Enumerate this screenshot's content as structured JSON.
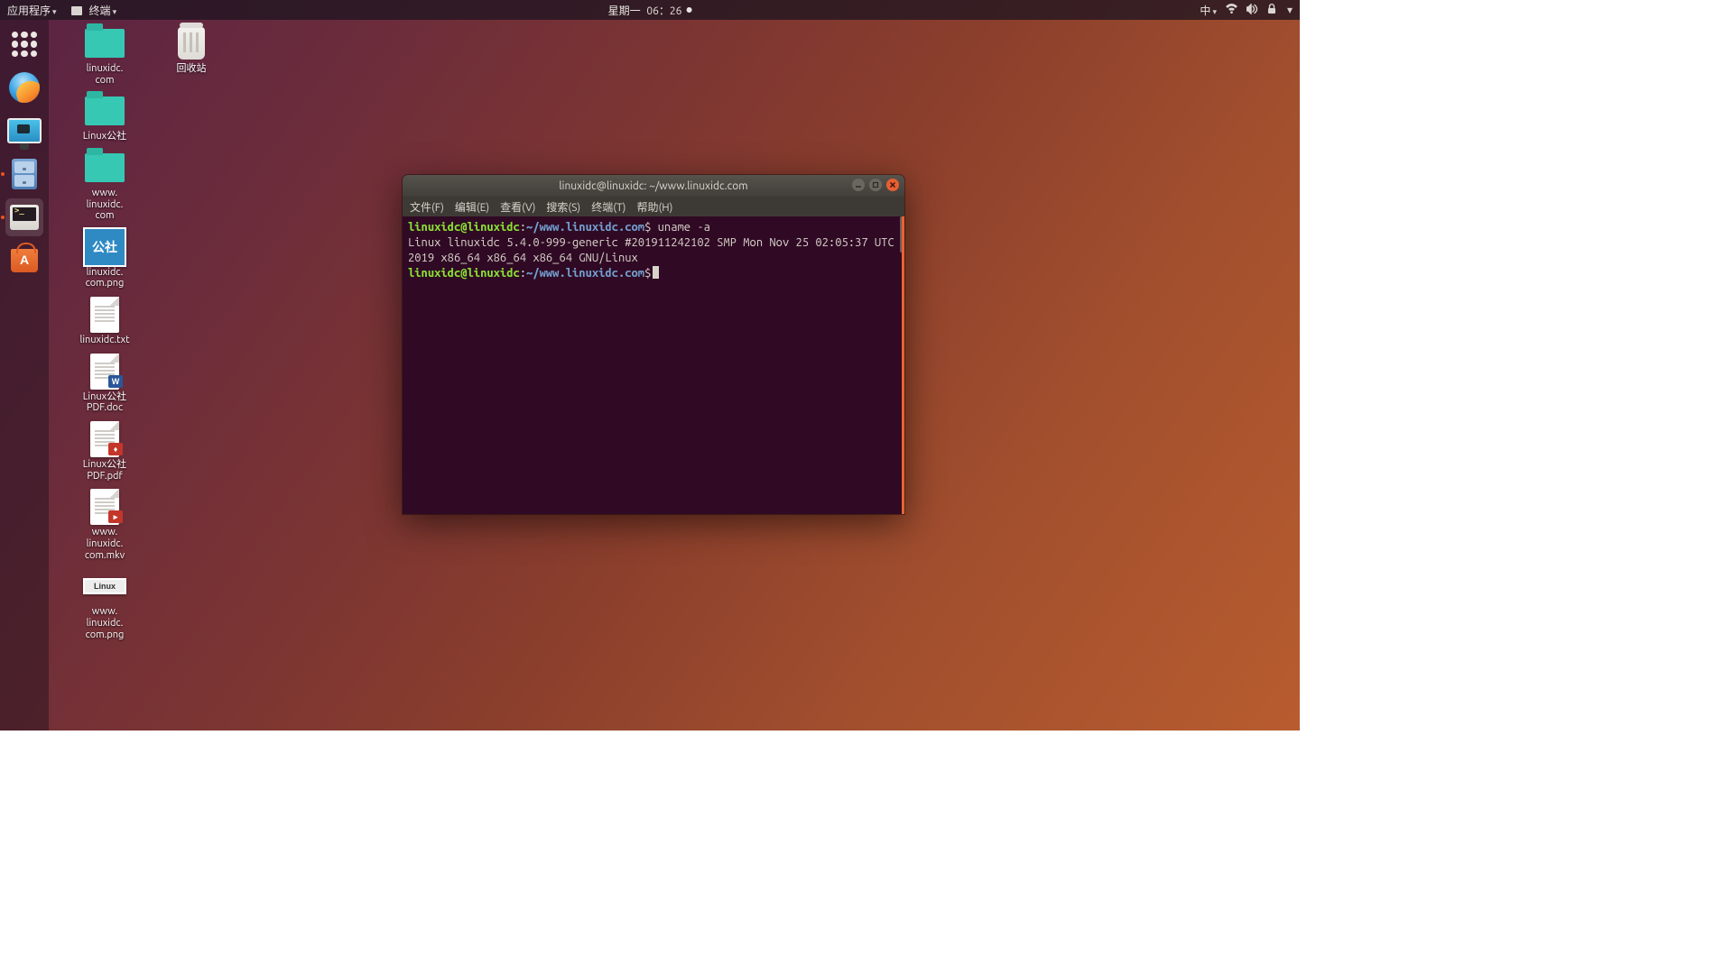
{
  "topbar": {
    "apps_label": "应用程序",
    "active_app": "终端",
    "date": "星期一",
    "time": "06：26",
    "ime": "中"
  },
  "desktop_icons": [
    {
      "type": "folder",
      "label": "linuxidc.\ncom"
    },
    {
      "type": "folder",
      "label": "Linux公社"
    },
    {
      "type": "folder",
      "label": "www.\nlinuxidc.\ncom"
    },
    {
      "type": "thumb",
      "thumb": "公社",
      "label": "linuxidc.\ncom.png"
    },
    {
      "type": "txt",
      "label": "linuxidc.txt"
    },
    {
      "type": "doc",
      "label": "Linux公社\nPDF.doc"
    },
    {
      "type": "pdf",
      "label": "Linux公社\nPDF.pdf"
    },
    {
      "type": "vid",
      "label": "www.\nlinuxidc.\ncom.mkv"
    },
    {
      "type": "smallthumb",
      "thumb": "Linux",
      "label": "www.\nlinuxidc.\ncom.png"
    }
  ],
  "trash_label": "回收站",
  "terminal": {
    "title": "linuxidc@linuxidc: ~/www.linuxidc.com",
    "menu": [
      "文件(F)",
      "编辑(E)",
      "查看(V)",
      "搜索(S)",
      "终端(T)",
      "帮助(H)"
    ],
    "user": "linuxidc@linuxidc",
    "path": "~/www.linuxidc.com",
    "cmd": "uname -a",
    "out": "Linux linuxidc 5.4.0-999-generic #201911242102 SMP Mon Nov 25 02:05:37 UTC 2019 x86_64 x86_64 x86_64 GNU/Linux"
  }
}
